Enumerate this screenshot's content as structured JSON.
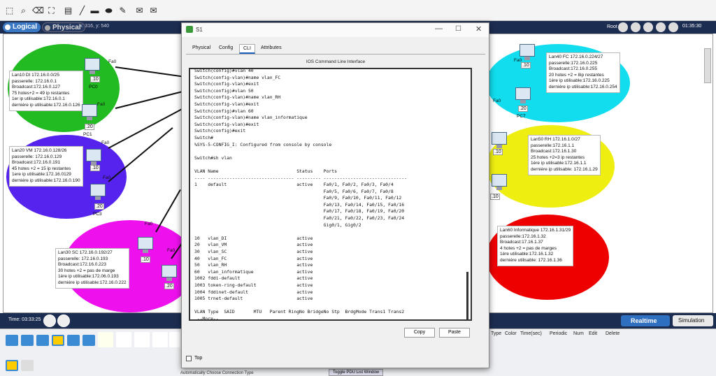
{
  "toolbar": {
    "icons": [
      "select-icon",
      "search-icon",
      "delete-icon",
      "resize-icon",
      "note-icon",
      "draw-line-icon",
      "rectangle-icon",
      "ellipse-icon",
      "freeform-icon",
      "simple-pdu-icon",
      "complex-pdu-icon"
    ]
  },
  "modebar": {
    "logical": "Logical",
    "physical": "Physical",
    "coords": "x: 316, y: 540",
    "root": "Root",
    "clock": "01:35:30"
  },
  "workspace": {
    "notes": [
      "Lan10 DI 172.16.0.0/25\npasserelle: 172.16.0.1\nBroadcast:172.16.0.127\n75 hotes+2 = 49 ip restantes\n1er ip utilisable:172.16.0.1\nderniére ip utilisable:172.16.0.126",
      "Lan20 VM 172.16.0.128/26\npasserelle: 172.16.0.129\nBroadcast:172.16.0.191\n45 hotes +2 = 15 ip restantes\n1ere ip utilisable:172.16.0129\nderniére ip utilisable:172.16.0.190",
      "Lan30 SC 172.16.0.192/27\npasserelle: 172.16.0.193\nBroadcast:172.16.0.223\n30 hotes +2 = pas de marge\n1ère ip utilisable:172.06.0.193\nderniére ip utilisable:172.16.0.222",
      "Lan40 FC 172.16.0.224/27\npasserelle:172.16.0.225\nBroadcast:172.16.0.255\n20 hotes +2 = 8ip restantes\n1ère ip utilisable:172.16.0.225\nderniére ip utilisable:172.16.0.254",
      "Lan50 RH 172.16.1.0/27\npasserelle:172.16.1.1\nBroadcast:172.16.1.30\n25 hotes +2=3 ip restantes\n1ère ip utilisable:172.16.1.1\nderniére ip utilisable: 172.16.1.29",
      "Lan60 Informatique 172.16.1.31/29\npasserelle:172.16.1.32\nBroadcast:17.16.1.37\n4 hotes +2 = pas de marges\n1ère utilisable:172.16.1.32\nderniére utilisable: 172.16.1.36"
    ],
    "port_fa0": "Fa0",
    "pcs": [
      ".10",
      ".20",
      ".10",
      ".20",
      ".10",
      ".20",
      ".10",
      ".20",
      ".10",
      ".10"
    ],
    "pc_names": [
      "PC0",
      "PC1",
      "PC2",
      "PC3",
      "PC4",
      "PC5",
      "PC6",
      "PC7",
      "PC8",
      "PC9"
    ]
  },
  "timebar": {
    "time": "Time: 03:33:25",
    "realtime": "Realtime",
    "simulation": "Simulation"
  },
  "bottom": {
    "event_headers": [
      "Type",
      "Color",
      "Time(sec)",
      "Periodic",
      "Num",
      "Edit",
      "Delete"
    ],
    "toggle": "Toggle PDU List Window",
    "scenario": "Automatically Choose Connection Type"
  },
  "window": {
    "title": "S1",
    "tabs": [
      "Physical",
      "Config",
      "CLI",
      "Attributes"
    ],
    "cli_header": "IOS Command Line Interface",
    "terminal": "Switch(config)#vlan 40\nSwitch(config-vlan)#name vlan_FC\nSwitch(config-vlan)#exit\nSwitch(config)#vlan 50\nSwitch(config-vlan)#name vlan_RH\nSwitch(config-vlan)#exit\nSwitch(config)#vlan 60\nSwitch(config-vlan)#name vlan_informatique\nSwitch(config-vlan)#exit\nSwitch(config)#exit\nSwitch#\n%SYS-5-CONFIG_I: Configured from console by console\n\nSwitch#sh vlan\n\nVLAN Name                             Status    Ports\n---- -------------------------------- --------- -------------------------------\n1    default                          active    Fa0/1, Fa0/2, Fa0/3, Fa0/4\n                                                Fa0/5, Fa0/6, Fa0/7, Fa0/8\n                                                Fa0/9, Fa0/10, Fa0/11, Fa0/12\n                                                Fa0/13, Fa0/14, Fa0/15, Fa0/16\n                                                Fa0/17, Fa0/18, Fa0/19, Fa0/20\n                                                Fa0/21, Fa0/22, Fa0/23, Fa0/24\n                                                Gig0/1, Gig0/2\n\n10   vlan_DI                          active\n20   vlan_VM                          active\n30   vlan_SC                          active\n40   vlan_FC                          active\n50   vlan_RH                          active\n60   vlan_informatique                active\n1002 fddi-default                     active\n1003 token-ring-default               active\n1004 fddinet-default                  active\n1005 trnet-default                    active\n\nVLAN Type  SAID       MTU   Parent RingNo BridgeNo Stp  BrdgMode Trans1 Trans2\n --More--",
    "copy": "Copy",
    "paste": "Paste",
    "top": "Top"
  }
}
